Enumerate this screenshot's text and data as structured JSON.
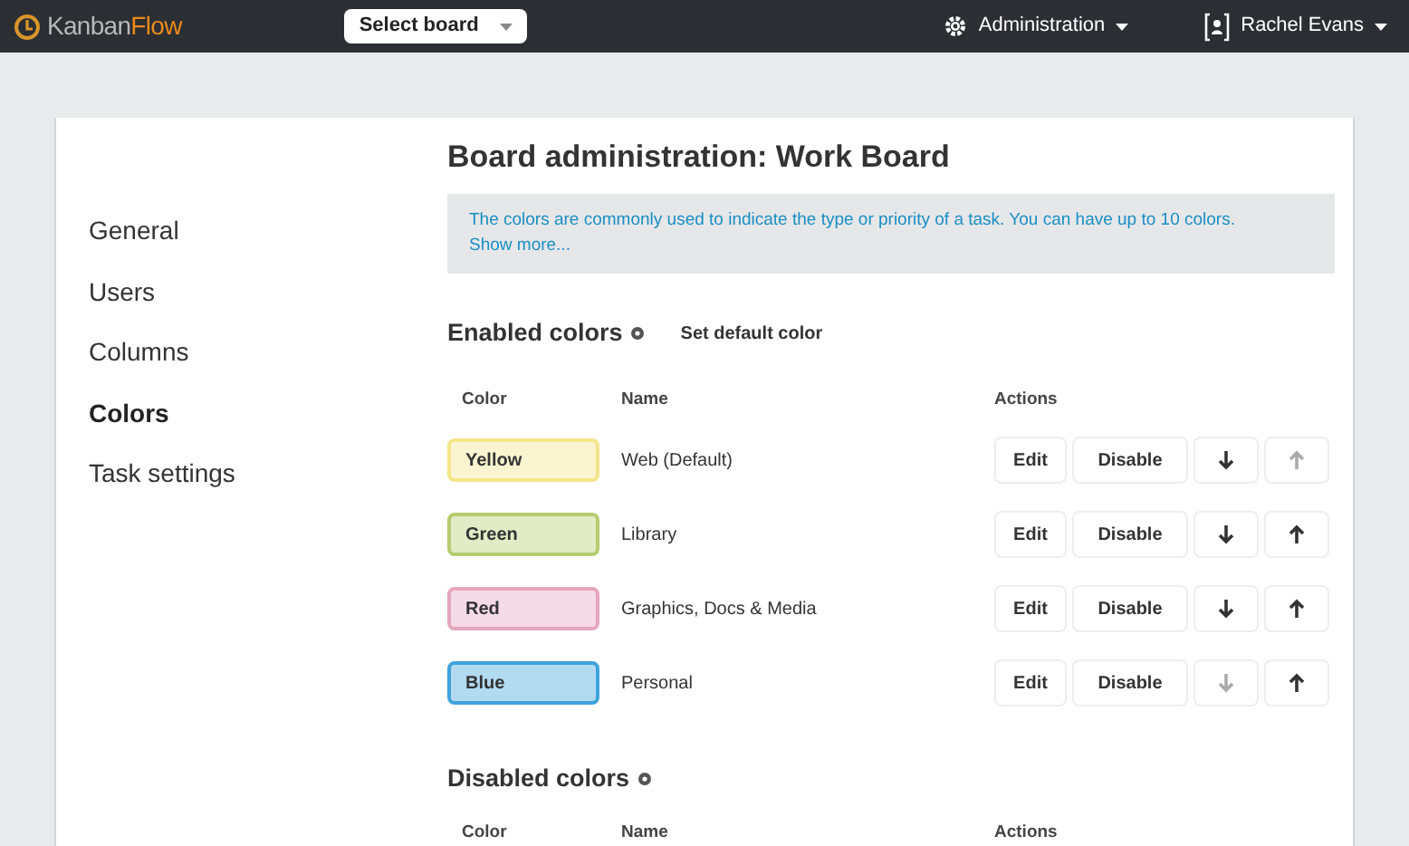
{
  "top_bar": {
    "logo": [
      "Kanban",
      "Flow"
    ],
    "board_select": "Select board",
    "admin_menu": "Administration",
    "user_menu": "Rachel Evans"
  },
  "title": "Board administration: Work Board",
  "sidebar": {
    "items": [
      {
        "label": "General",
        "selected": false
      },
      {
        "label": "Users",
        "selected": false
      },
      {
        "label": "Columns",
        "selected": false
      },
      {
        "label": "Colors",
        "selected": true
      },
      {
        "label": "Task settings",
        "selected": false
      }
    ]
  },
  "info": {
    "text": "The colors are commonly used to indicate the type or priority of a task. You can have up to 10 colors.",
    "link": "Show more..."
  },
  "enabled": {
    "heading": "Enabled colors",
    "set_default_button": "Set default color",
    "columns": [
      "Color",
      "Name",
      "Actions"
    ],
    "rows": [
      {
        "color_label": "Yellow",
        "color": "#f3e58a",
        "name": "Web (Default)",
        "edit": "Edit",
        "disable": "Disable",
        "down_disabled": false,
        "up_disabled": true
      },
      {
        "color_label": "Green",
        "color": "#b5cc6e",
        "name": "Library",
        "edit": "Edit",
        "disable": "Disable",
        "down_disabled": false,
        "up_disabled": false
      },
      {
        "color_label": "Red",
        "color": "#e5a6bd",
        "name": "Graphics, Docs & Media",
        "edit": "Edit",
        "disable": "Disable",
        "down_disabled": false,
        "up_disabled": false
      },
      {
        "color_label": "Blue",
        "color": "#3fa3dc",
        "name": "Personal",
        "edit": "Edit",
        "disable": "Disable",
        "down_disabled": true,
        "up_disabled": false
      }
    ]
  },
  "disabled": {
    "heading": "Disabled colors",
    "columns": [
      "Color",
      "Name",
      "Actions"
    ]
  }
}
